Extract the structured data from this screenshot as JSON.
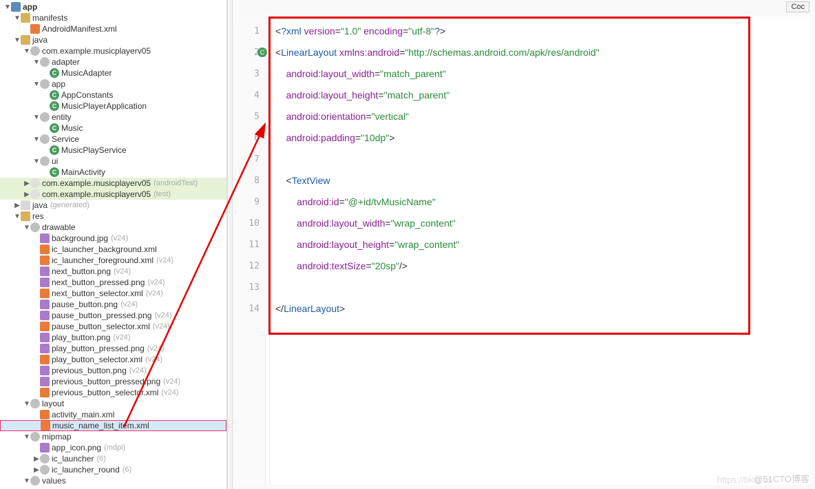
{
  "topbar": {
    "code_btn": "Coc"
  },
  "tree": {
    "root": "app",
    "items": [
      {
        "depth": 0,
        "arrow": "open",
        "icon": "mod",
        "label": "app",
        "bold": true
      },
      {
        "depth": 1,
        "arrow": "open",
        "icon": "fldr",
        "label": "manifests"
      },
      {
        "depth": 2,
        "arrow": "none",
        "icon": "xml",
        "label": "AndroidManifest.xml"
      },
      {
        "depth": 1,
        "arrow": "open",
        "icon": "fldr",
        "label": "java"
      },
      {
        "depth": 2,
        "arrow": "open",
        "icon": "pkg",
        "label": "com.example.musicplayerv05"
      },
      {
        "depth": 3,
        "arrow": "open",
        "icon": "pkg",
        "label": "adapter"
      },
      {
        "depth": 4,
        "arrow": "none",
        "icon": "c",
        "label": "MusicAdapter"
      },
      {
        "depth": 3,
        "arrow": "open",
        "icon": "pkg",
        "label": "app"
      },
      {
        "depth": 4,
        "arrow": "none",
        "icon": "c",
        "label": "AppConstants"
      },
      {
        "depth": 4,
        "arrow": "none",
        "icon": "c",
        "label": "MusicPlayerApplication"
      },
      {
        "depth": 3,
        "arrow": "open",
        "icon": "pkg",
        "label": "entity"
      },
      {
        "depth": 4,
        "arrow": "none",
        "icon": "c",
        "label": "Music"
      },
      {
        "depth": 3,
        "arrow": "open",
        "icon": "pkg",
        "label": "Service"
      },
      {
        "depth": 4,
        "arrow": "none",
        "icon": "c",
        "label": "MusicPlayService"
      },
      {
        "depth": 3,
        "arrow": "open",
        "icon": "pkg",
        "label": "ui"
      },
      {
        "depth": 4,
        "arrow": "none",
        "icon": "c",
        "label": "MainActivity"
      },
      {
        "depth": 2,
        "arrow": "closed",
        "icon": "pkg-g",
        "label": "com.example.musicplayerv05",
        "hint": "(androidTest)",
        "sel": "green"
      },
      {
        "depth": 2,
        "arrow": "closed",
        "icon": "pkg-g",
        "label": "com.example.musicplayerv05",
        "hint": "(test)",
        "sel": "green"
      },
      {
        "depth": 1,
        "arrow": "closed",
        "icon": "fldr-g",
        "label": "java",
        "hint": "(generated)"
      },
      {
        "depth": 1,
        "arrow": "open",
        "icon": "fldr",
        "label": "res"
      },
      {
        "depth": 2,
        "arrow": "open",
        "icon": "pkg",
        "label": "drawable"
      },
      {
        "depth": 3,
        "arrow": "none",
        "icon": "png",
        "label": "background.jpg",
        "hint": "(v24)"
      },
      {
        "depth": 3,
        "arrow": "none",
        "icon": "orange",
        "label": "ic_launcher_background.xml"
      },
      {
        "depth": 3,
        "arrow": "none",
        "icon": "orange",
        "label": "ic_launcher_foreground.xml",
        "hint": "(v24)"
      },
      {
        "depth": 3,
        "arrow": "none",
        "icon": "png",
        "label": "next_button.png",
        "hint": "(v24)"
      },
      {
        "depth": 3,
        "arrow": "none",
        "icon": "png",
        "label": "next_button_pressed.png",
        "hint": "(v24)"
      },
      {
        "depth": 3,
        "arrow": "none",
        "icon": "orange",
        "label": "next_button_selector.xml",
        "hint": "(v24)"
      },
      {
        "depth": 3,
        "arrow": "none",
        "icon": "png",
        "label": "pause_button.png",
        "hint": "(v24)"
      },
      {
        "depth": 3,
        "arrow": "none",
        "icon": "png",
        "label": "pause_button_pressed.png",
        "hint": "(v24)"
      },
      {
        "depth": 3,
        "arrow": "none",
        "icon": "orange",
        "label": "pause_button_selector.xml",
        "hint": "(v24)"
      },
      {
        "depth": 3,
        "arrow": "none",
        "icon": "png",
        "label": "play_button.png",
        "hint": "(v24)"
      },
      {
        "depth": 3,
        "arrow": "none",
        "icon": "png",
        "label": "play_button_pressed.png",
        "hint": "(v24)"
      },
      {
        "depth": 3,
        "arrow": "none",
        "icon": "orange",
        "label": "play_button_selector.xml",
        "hint": "(v24)"
      },
      {
        "depth": 3,
        "arrow": "none",
        "icon": "png",
        "label": "previous_button.png",
        "hint": "(v24)"
      },
      {
        "depth": 3,
        "arrow": "none",
        "icon": "png",
        "label": "previous_button_pressed.png",
        "hint": "(v24)"
      },
      {
        "depth": 3,
        "arrow": "none",
        "icon": "orange",
        "label": "previous_button_selector.xml",
        "hint": "(v24)"
      },
      {
        "depth": 2,
        "arrow": "open",
        "icon": "pkg",
        "label": "layout"
      },
      {
        "depth": 3,
        "arrow": "none",
        "icon": "orange",
        "label": "activity_main.xml"
      },
      {
        "depth": 3,
        "arrow": "none",
        "icon": "orange",
        "label": "music_name_list_item.xml",
        "sel": "blue",
        "boxed": true
      },
      {
        "depth": 2,
        "arrow": "open",
        "icon": "pkg",
        "label": "mipmap"
      },
      {
        "depth": 3,
        "arrow": "none",
        "icon": "png",
        "label": "app_icon.png",
        "hint": "(mdpi)"
      },
      {
        "depth": 3,
        "arrow": "closed",
        "icon": "pkg",
        "label": "ic_launcher",
        "hint": "(6)"
      },
      {
        "depth": 3,
        "arrow": "closed",
        "icon": "pkg",
        "label": "ic_launcher_round",
        "hint": "(6)"
      },
      {
        "depth": 2,
        "arrow": "open",
        "icon": "pkg",
        "label": "values"
      }
    ]
  },
  "code": {
    "lines": [
      {
        "n": 1,
        "segs": [
          [
            "txt",
            "<"
          ],
          [
            "tag",
            "?xml "
          ],
          [
            "attr",
            "version"
          ],
          [
            "txt",
            "="
          ],
          [
            "val",
            "\"1.0\""
          ],
          [
            "txt",
            " "
          ],
          [
            "attr",
            "encoding"
          ],
          [
            "txt",
            "="
          ],
          [
            "val",
            "\"utf-8\""
          ],
          [
            "tag",
            "?"
          ],
          [
            "txt",
            ">"
          ]
        ]
      },
      {
        "n": 2,
        "mark": "C",
        "segs": [
          [
            "txt",
            "<"
          ],
          [
            "tag",
            "LinearLayout "
          ],
          [
            "attr",
            "xmlns:android"
          ],
          [
            "txt",
            "="
          ],
          [
            "val",
            "\"http://schemas.android.com/apk/res/android\""
          ]
        ]
      },
      {
        "n": 3,
        "segs": [
          [
            "txt",
            "    "
          ],
          [
            "attr",
            "android:layout_width"
          ],
          [
            "txt",
            "="
          ],
          [
            "val",
            "\"match_parent\""
          ]
        ]
      },
      {
        "n": 4,
        "segs": [
          [
            "txt",
            "    "
          ],
          [
            "attr",
            "android:layout_height"
          ],
          [
            "txt",
            "="
          ],
          [
            "val",
            "\"match_parent\""
          ]
        ]
      },
      {
        "n": 5,
        "segs": [
          [
            "txt",
            "    "
          ],
          [
            "attr",
            "android:orientation"
          ],
          [
            "txt",
            "="
          ],
          [
            "val",
            "\"vertical\""
          ]
        ]
      },
      {
        "n": 6,
        "segs": [
          [
            "txt",
            "    "
          ],
          [
            "attr",
            "android:padding"
          ],
          [
            "txt",
            "="
          ],
          [
            "val",
            "\"10dp\""
          ],
          [
            "txt",
            ">"
          ]
        ]
      },
      {
        "n": 7,
        "segs": []
      },
      {
        "n": 8,
        "segs": [
          [
            "txt",
            "    <"
          ],
          [
            "tag",
            "TextView"
          ]
        ]
      },
      {
        "n": 9,
        "segs": [
          [
            "txt",
            "        "
          ],
          [
            "attr",
            "android:id"
          ],
          [
            "txt",
            "="
          ],
          [
            "val",
            "\"@+id/tvMusicName\""
          ]
        ]
      },
      {
        "n": 10,
        "segs": [
          [
            "txt",
            "        "
          ],
          [
            "attr",
            "android:layout_width"
          ],
          [
            "txt",
            "="
          ],
          [
            "val",
            "\"wrap_content\""
          ]
        ]
      },
      {
        "n": 11,
        "segs": [
          [
            "txt",
            "        "
          ],
          [
            "attr",
            "android:layout_height"
          ],
          [
            "txt",
            "="
          ],
          [
            "val",
            "\"wrap_content\""
          ]
        ]
      },
      {
        "n": 12,
        "segs": [
          [
            "txt",
            "        "
          ],
          [
            "attr",
            "android:textSize"
          ],
          [
            "txt",
            "="
          ],
          [
            "val",
            "\"20sp\""
          ],
          [
            "txt",
            "/>"
          ]
        ]
      },
      {
        "n": 13,
        "segs": []
      },
      {
        "n": 14,
        "segs": [
          [
            "txt",
            "</"
          ],
          [
            "tag",
            "LinearLayout"
          ],
          [
            "txt",
            ">"
          ]
        ]
      }
    ]
  },
  "watermark1": "https://blog.cs",
  "watermark2": "@51CTO博客"
}
